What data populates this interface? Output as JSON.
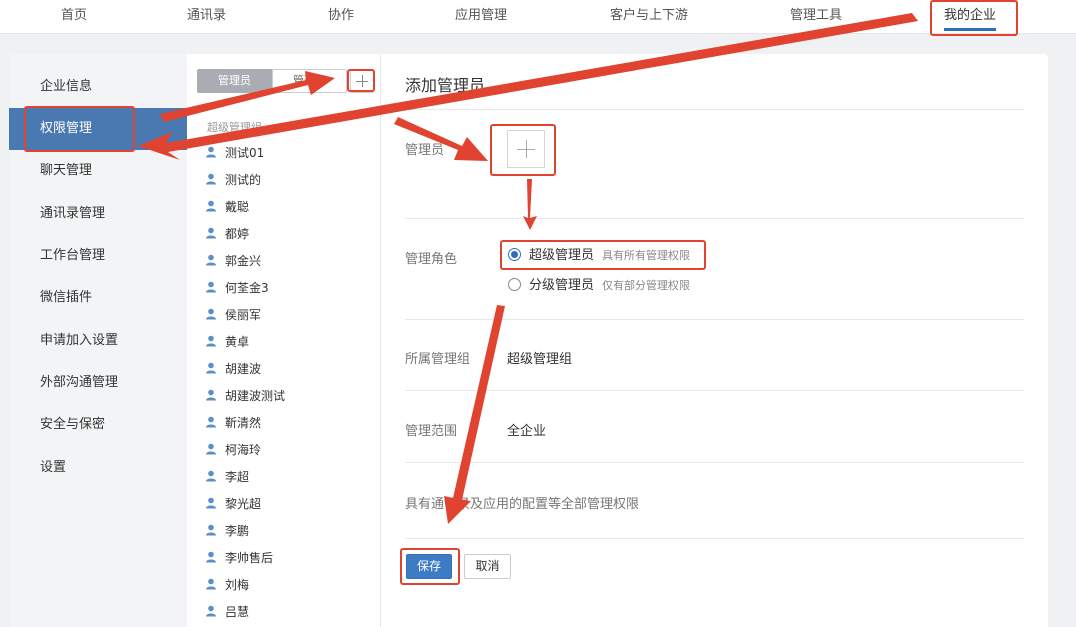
{
  "topnav": {
    "items": [
      {
        "label": "首页"
      },
      {
        "label": "通讯录"
      },
      {
        "label": "协作"
      },
      {
        "label": "应用管理"
      },
      {
        "label": "客户与上下游"
      },
      {
        "label": "管理工具"
      },
      {
        "label": "我的企业",
        "active": true
      }
    ]
  },
  "sidebar": {
    "items": [
      {
        "label": "企业信息"
      },
      {
        "label": "权限管理",
        "active": true
      },
      {
        "label": "聊天管理"
      },
      {
        "label": "通讯录管理"
      },
      {
        "label": "工作台管理"
      },
      {
        "label": "微信插件"
      },
      {
        "label": "申请加入设置"
      },
      {
        "label": "外部沟通管理"
      },
      {
        "label": "安全与保密"
      },
      {
        "label": "设置"
      }
    ]
  },
  "admin_panel": {
    "tab_admin": "管理员",
    "tab_group": "管理组",
    "section_title": "超级管理组",
    "admins": [
      "测试01",
      "测试的",
      "戴聪",
      "都婷",
      "郭金兴",
      "何荃金3",
      "侯丽军",
      "黄卓",
      "胡建波",
      "胡建波测试",
      "靳清然",
      "柯海玲",
      "李超",
      "黎光超",
      "李鹏",
      "李帅售后",
      "刘梅",
      "吕慧"
    ]
  },
  "form": {
    "title": "添加管理员",
    "admin_label": "管理员",
    "role_label": "管理角色",
    "roles": [
      {
        "label": "超级管理员",
        "hint": "具有所有管理权限",
        "checked": true
      },
      {
        "label": "分级管理员",
        "hint": "仅有部分管理权限",
        "checked": false
      }
    ],
    "group_label": "所属管理组",
    "group_value": "超级管理组",
    "scope_label": "管理范围",
    "scope_value": "全企业",
    "description": "具有通讯录及应用的配置等全部管理权限",
    "save_label": "保存",
    "cancel_label": "取消"
  },
  "colors": {
    "accent": "#2f6fb2",
    "sidebar_active": "#4a78b0",
    "annotation": "#e0432f"
  }
}
